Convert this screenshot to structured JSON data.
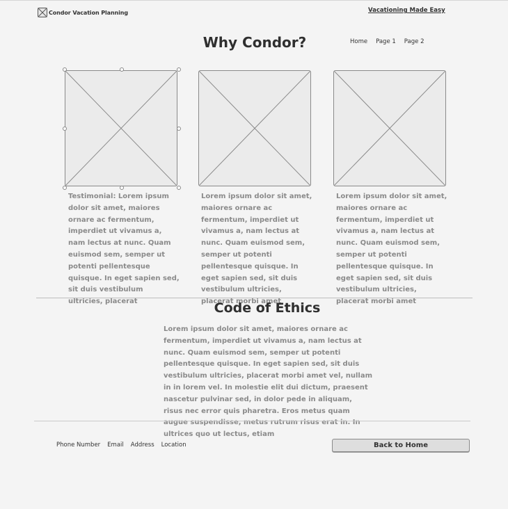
{
  "header": {
    "logo_icon": "image-placeholder-icon",
    "logo_text": "Condor Vacation Planning",
    "tagline": "Vacationing Made Easy"
  },
  "nav": {
    "items": [
      "Home",
      "Page 1",
      "Page 2"
    ]
  },
  "hero": {
    "title": "Why Condor?"
  },
  "cards": [
    {
      "image": "image-placeholder",
      "text": "Testimonial: Lorem ipsum dolor sit amet, maiores ornare ac fermentum, imperdiet ut vivamus a, nam lectus at nunc. Quam euismod sem, semper ut potenti pellentesque quisque. In eget sapien sed, sit duis vestibulum ultricies, placerat"
    },
    {
      "image": "image-placeholder",
      "text": "Lorem ipsum dolor sit amet, maiores ornare ac fermentum, imperdiet ut vivamus a, nam lectus at nunc. Quam euismod sem, semper ut potenti pellentesque quisque. In eget sapien sed, sit duis vestibulum ultricies, placerat morbi amet"
    },
    {
      "image": "image-placeholder",
      "text": "Lorem ipsum dolor sit amet, maiores ornare ac fermentum, imperdiet ut vivamus a, nam lectus at nunc. Quam euismod sem, semper ut potenti pellentesque quisque. In eget sapien sed, sit duis vestibulum ultricies, placerat morbi amet"
    }
  ],
  "ethics": {
    "title": "Code of Ethics",
    "text": "Lorem ipsum dolor sit amet, maiores ornare ac fermentum, imperdiet ut vivamus a, nam lectus at nunc. Quam euismod sem, semper ut potenti pellentesque quisque. In eget sapien sed, sit duis vestibulum ultricies, placerat morbi amet vel, nullam in in lorem vel. In molestie elit dui dictum, praesent nascetur pulvinar sed, in dolor pede in aliquam, risus nec error quis pharetra. Eros metus quam augue suspendisse, metus rutrum risus erat in.  In ultrices quo ut lectus, etiam"
  },
  "footer": {
    "links": [
      "Phone Number",
      "Email",
      "Address",
      "Location"
    ],
    "back_button": "Back to Home"
  },
  "colors": {
    "background": "#f4f4f4",
    "placeholder_fill": "#ebebeb",
    "border": "#8a8a8a",
    "body_text": "#8a8a8a",
    "heading_text": "#2f2f2f"
  }
}
